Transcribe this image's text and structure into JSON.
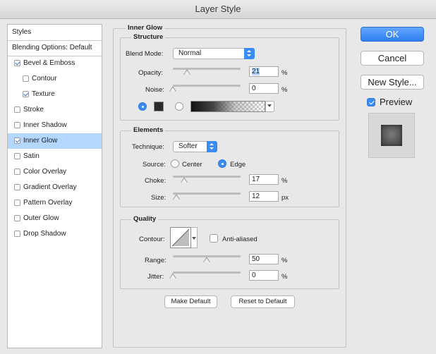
{
  "window": {
    "title": "Layer Style"
  },
  "styles_list": {
    "header": "Styles",
    "blending": "Blending Options: Default",
    "items": [
      {
        "label": "Bevel & Emboss",
        "checked": true
      },
      {
        "label": "Contour",
        "checked": false
      },
      {
        "label": "Texture",
        "checked": true
      },
      {
        "label": "Stroke",
        "checked": false
      },
      {
        "label": "Inner Shadow",
        "checked": false
      },
      {
        "label": "Inner Glow",
        "checked": true
      },
      {
        "label": "Satin",
        "checked": false
      },
      {
        "label": "Color Overlay",
        "checked": false
      },
      {
        "label": "Gradient Overlay",
        "checked": false
      },
      {
        "label": "Pattern Overlay",
        "checked": false
      },
      {
        "label": "Outer Glow",
        "checked": false
      },
      {
        "label": "Drop Shadow",
        "checked": false
      }
    ],
    "selected": "Inner Glow"
  },
  "panel": {
    "title": "Inner Glow",
    "structure": {
      "title": "Structure",
      "blend_mode_label": "Blend Mode:",
      "blend_mode_value": "Normal",
      "opacity_label": "Opacity:",
      "opacity_value": "21",
      "opacity_unit": "%",
      "opacity_slider": 0.21,
      "noise_label": "Noise:",
      "noise_value": "0",
      "noise_unit": "%",
      "noise_slider": 0.0,
      "color": "#2a2a2a"
    },
    "elements": {
      "title": "Elements",
      "technique_label": "Technique:",
      "technique_value": "Softer",
      "source_label": "Source:",
      "source_center": "Center",
      "source_edge": "Edge",
      "source_selected": "Edge",
      "choke_label": "Choke:",
      "choke_value": "17",
      "choke_unit": "%",
      "choke_slider": 0.17,
      "size_label": "Size:",
      "size_value": "12",
      "size_unit": "px",
      "size_slider": 0.05
    },
    "quality": {
      "title": "Quality",
      "contour_label": "Contour:",
      "anti_aliased_label": "Anti-aliased",
      "anti_aliased": false,
      "range_label": "Range:",
      "range_value": "50",
      "range_unit": "%",
      "range_slider": 0.5,
      "jitter_label": "Jitter:",
      "jitter_value": "0",
      "jitter_unit": "%",
      "jitter_slider": 0.0
    },
    "make_default": "Make Default",
    "reset_default": "Reset to Default"
  },
  "buttons": {
    "ok": "OK",
    "cancel": "Cancel",
    "new_style": "New Style..."
  },
  "preview": {
    "label": "Preview",
    "checked": true
  },
  "colors": {
    "accent": "#3b8bf5",
    "selection": "#b3d7ff"
  }
}
